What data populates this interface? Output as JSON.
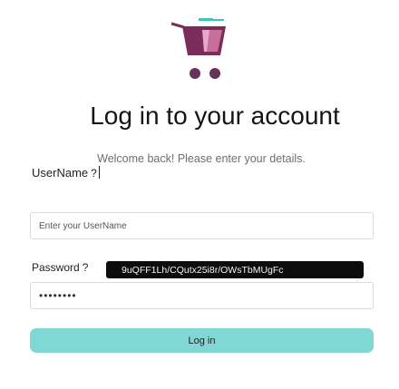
{
  "header": {
    "title": "Log in to your account",
    "subtitle": "Welcome back! Please enter your details."
  },
  "logo": {
    "icon": "shopping-cart-icon",
    "colors": {
      "basket": "#7b2d59",
      "basket_light": "#c76e9d",
      "wheels": "#66325a",
      "motion_lines": "#38c6bd"
    }
  },
  "form": {
    "username": {
      "label": "UserName",
      "hint": "?",
      "placeholder": "Enter your UserName"
    },
    "password": {
      "label": "Password",
      "hint": "?",
      "value_masked": "••••••••",
      "tooltip": "9uQFF1Lh/CQutx25i8r/OWsTbMUgFc"
    },
    "login_label": "Log in"
  },
  "colors": {
    "accent": "#7fd8d3",
    "tooltip_bg": "#0c0c0c",
    "subtitle": "#6e6e6e"
  }
}
